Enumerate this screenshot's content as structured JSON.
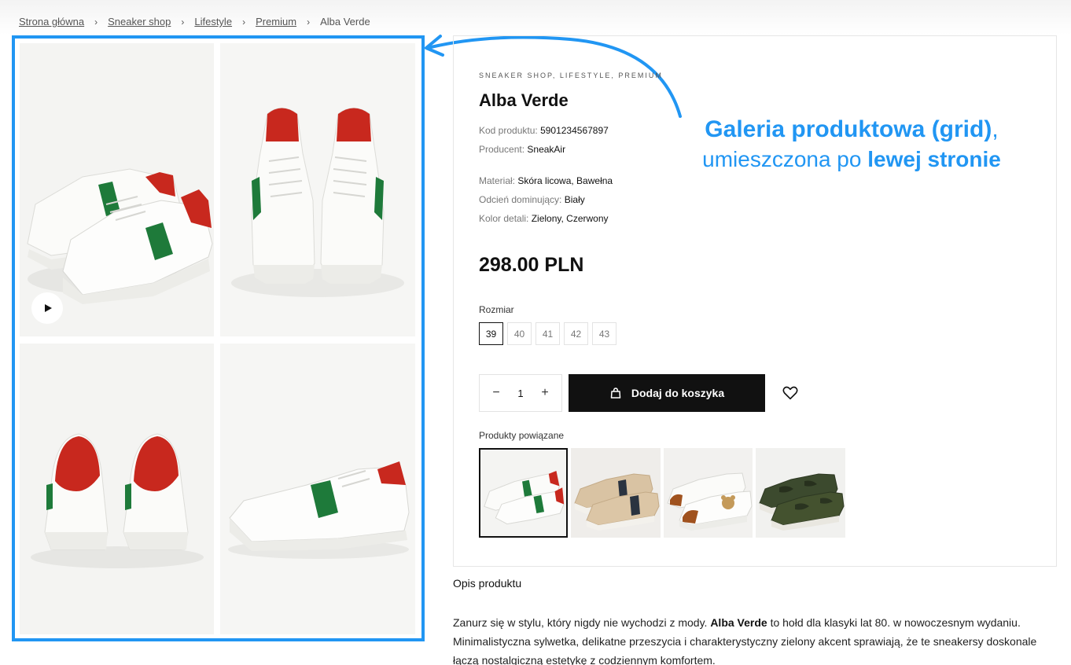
{
  "breadcrumb": {
    "items": [
      "Strona główna",
      "Sneaker shop",
      "Lifestyle",
      "Premium"
    ],
    "current": "Alba Verde",
    "separator": "›"
  },
  "gallery": {
    "images": [
      "sneaker-pair-side",
      "sneaker-pair-front",
      "sneaker-pair-back",
      "sneaker-single-side"
    ],
    "play_icon": "play-icon"
  },
  "annotation": {
    "line1_bold": "Galeria produktowa (grid)",
    "line1_rest": ",",
    "line2_plain": "umieszczona po ",
    "line2_bold": "lewej stronie",
    "color": "#2196f3"
  },
  "product": {
    "category": "SNEAKER SHOP, LIFESTYLE, PREMIUM",
    "title": "Alba Verde",
    "attributes": [
      {
        "label": "Kod produktu:",
        "value": "5901234567897"
      },
      {
        "label": "Producent:",
        "value": "SneakAir"
      },
      {
        "label": "Materiał:",
        "value": "Skóra licowa, Bawełna"
      },
      {
        "label": "Odcień dominujący:",
        "value": "Biały"
      },
      {
        "label": "Kolor detali:",
        "value": "Zielony, Czerwony"
      }
    ],
    "price": "298.00 PLN",
    "size_label": "Rozmiar",
    "sizes": [
      "39",
      "40",
      "41",
      "42",
      "43"
    ],
    "selected_size": "39",
    "quantity": "1",
    "qty_minus": "−",
    "qty_plus": "+",
    "add_to_cart": "Dodaj do koszyka",
    "related_label": "Produkty powiązane",
    "related": [
      "alba-verde",
      "beige-navy-stripe",
      "white-bear-patch",
      "camo-green"
    ]
  },
  "description": {
    "title": "Opis produktu",
    "text_before": "Zanurz się w stylu, który nigdy nie wychodzi z mody. ",
    "text_bold": "Alba Verde",
    "text_after": " to hołd dla klasyki lat 80. w nowoczesnym wydaniu. Minimalistyczna sylwetka, delikatne przeszycia i charakterystyczny zielony akcent sprawiają, że te sneakersy doskonale łączą nostalgiczną estetykę z codziennym komfortem."
  },
  "colors": {
    "accent": "#2196f3",
    "button": "#111111",
    "shoe_green": "#1e7a3a",
    "shoe_red": "#c8281e"
  }
}
